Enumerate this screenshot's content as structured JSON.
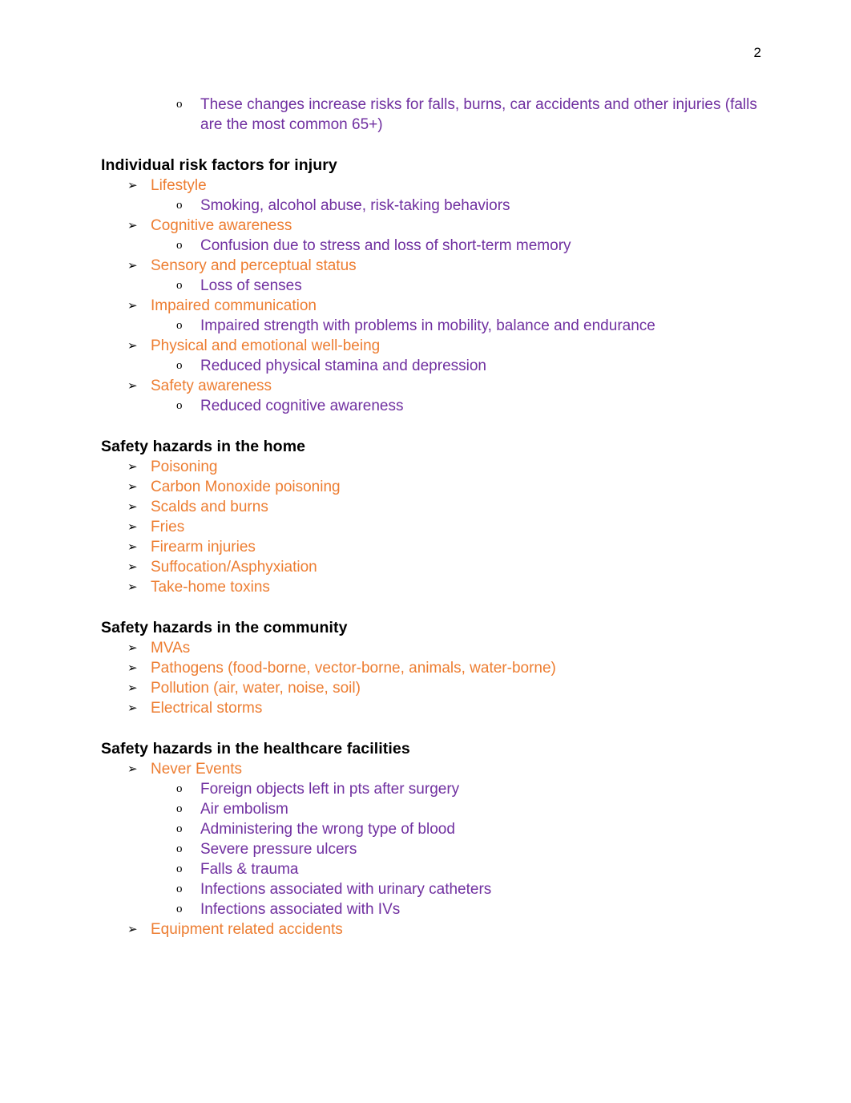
{
  "document": {
    "page_number": "2",
    "colors": {
      "level1_text": "#ED7D31",
      "level2_text": "#7030A0",
      "heading_text": "#000000",
      "bullet": "#000000",
      "background": "#FFFFFF"
    },
    "bullets": {
      "level1_glyph": "➢",
      "level2_glyph": "o"
    }
  },
  "blocks": [
    {
      "type": "list",
      "items": [
        {
          "level": 2,
          "text": "These changes increase risks for falls, burns, car accidents and other injuries (falls are the most common 65+)"
        }
      ]
    },
    {
      "type": "heading",
      "text": "Individual risk factors for injury"
    },
    {
      "type": "list",
      "items": [
        {
          "level": 1,
          "text": "Lifestyle"
        },
        {
          "level": 2,
          "text": "Smoking, alcohol abuse, risk-taking behaviors"
        },
        {
          "level": 1,
          "text": "Cognitive awareness"
        },
        {
          "level": 2,
          "text": "Confusion due to stress and loss of short-term memory"
        },
        {
          "level": 1,
          "text": "Sensory and perceptual status"
        },
        {
          "level": 2,
          "text": "Loss of senses"
        },
        {
          "level": 1,
          "text": "Impaired communication"
        },
        {
          "level": 2,
          "text": "Impaired strength with problems in mobility, balance and endurance"
        },
        {
          "level": 1,
          "text": "Physical and emotional well-being"
        },
        {
          "level": 2,
          "text": "Reduced physical stamina and depression"
        },
        {
          "level": 1,
          "text": "Safety awareness"
        },
        {
          "level": 2,
          "text": "Reduced cognitive awareness"
        }
      ]
    },
    {
      "type": "heading",
      "text": "Safety hazards in the home"
    },
    {
      "type": "list",
      "items": [
        {
          "level": 1,
          "text": "Poisoning"
        },
        {
          "level": 1,
          "text": "Carbon Monoxide poisoning"
        },
        {
          "level": 1,
          "text": "Scalds and burns"
        },
        {
          "level": 1,
          "text": "Fries"
        },
        {
          "level": 1,
          "text": "Firearm injuries"
        },
        {
          "level": 1,
          "text": "Suffocation/Asphyxiation"
        },
        {
          "level": 1,
          "text": "Take-home toxins"
        }
      ]
    },
    {
      "type": "heading",
      "text": "Safety hazards in the community"
    },
    {
      "type": "list",
      "items": [
        {
          "level": 1,
          "text": "MVAs"
        },
        {
          "level": 1,
          "text": "Pathogens (food-borne, vector-borne, animals, water-borne)"
        },
        {
          "level": 1,
          "text": "Pollution (air, water, noise, soil)"
        },
        {
          "level": 1,
          "text": "Electrical storms"
        }
      ]
    },
    {
      "type": "heading",
      "text": "Safety hazards in the healthcare facilities"
    },
    {
      "type": "list",
      "items": [
        {
          "level": 1,
          "text": "Never Events"
        },
        {
          "level": 2,
          "text": "Foreign objects left in pts after surgery"
        },
        {
          "level": 2,
          "text": "Air embolism"
        },
        {
          "level": 2,
          "text": "Administering the wrong type of blood"
        },
        {
          "level": 2,
          "text": "Severe pressure ulcers"
        },
        {
          "level": 2,
          "text": "Falls & trauma"
        },
        {
          "level": 2,
          "text": "Infections associated with urinary catheters"
        },
        {
          "level": 2,
          "text": "Infections associated with IVs"
        },
        {
          "level": 1,
          "text": "Equipment related accidents"
        }
      ]
    }
  ]
}
